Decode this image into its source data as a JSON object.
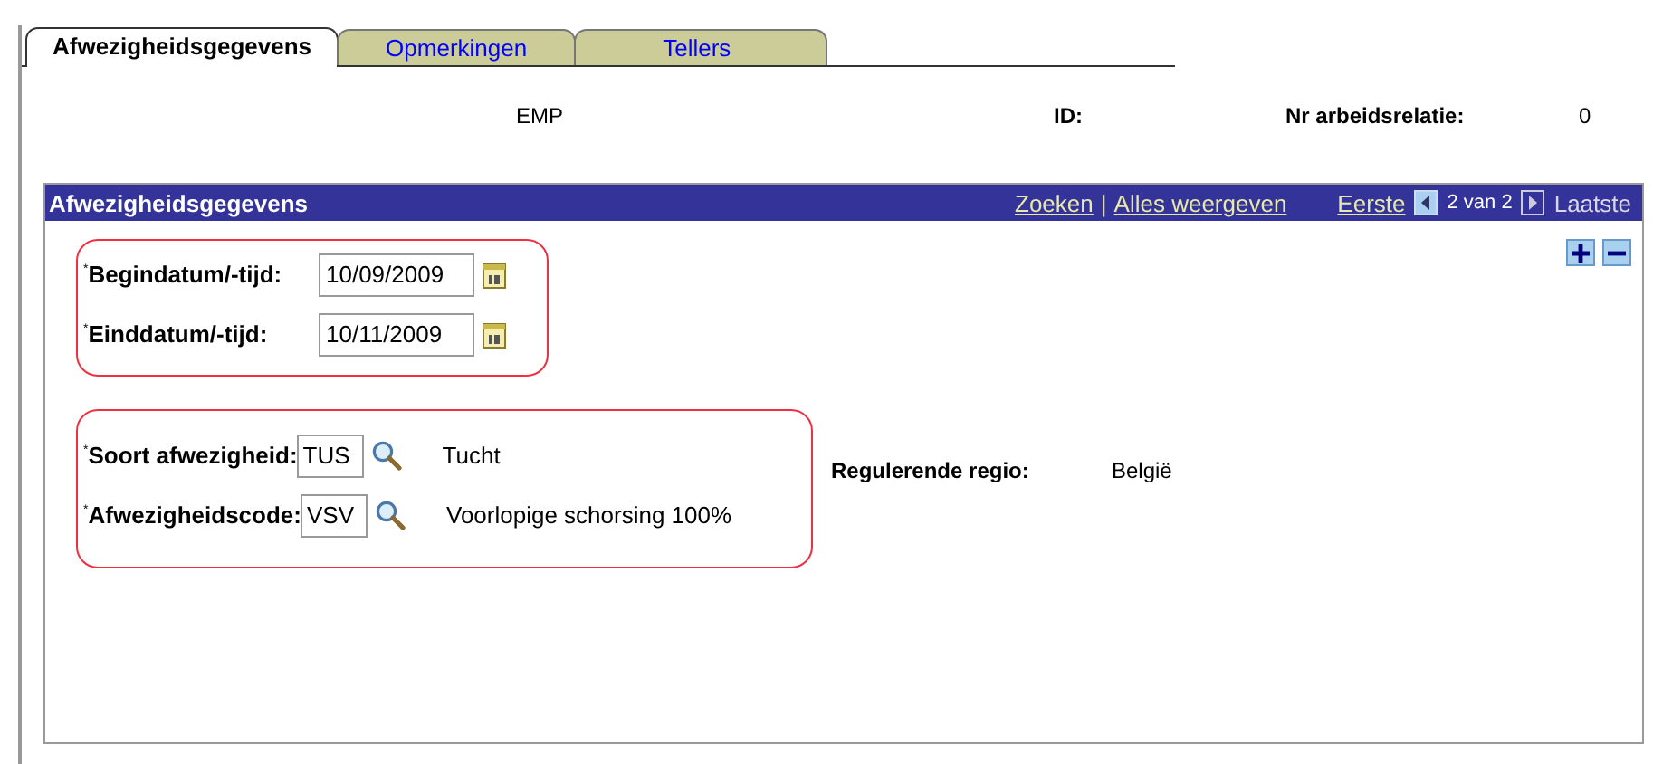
{
  "tabs": [
    {
      "label": "Afwezigheidsgegevens",
      "selected": true
    },
    {
      "label": "Opmerkingen",
      "selected": false
    },
    {
      "label": "Tellers",
      "selected": false
    }
  ],
  "header": {
    "employee": "EMP",
    "id_label": "ID:",
    "relation_label": "Nr arbeidsrelatie:",
    "relation_value": "0"
  },
  "panel": {
    "title": "Afwezigheidsgegevens",
    "links": [
      "Zoeken",
      "Alles weergeven"
    ],
    "separator": "|",
    "nav": {
      "first": {
        "label": "Eerste",
        "disabled": false
      },
      "position": "2 van 2",
      "last": {
        "label": "Laatste",
        "disabled": true
      }
    },
    "date_fields": [
      {
        "label": "$^{*}$Begindatum/-tijd:",
        "value": "10/09/2009"
      },
      {
        "label": "$^{*}$Einddatum/-tijd:",
        "value": "10/11/2009"
      }
    ],
    "code_fields": [
      {
        "label": "$^{*}$Soort afwezigheid:",
        "value": "TUS",
        "description": "Tucht"
      },
      {
        "label": "$^{*}$Afwezigheidscode:",
        "value": "VSV",
        "description": "Voorlopige schorsing 100%"
      }
    ],
    "region": {
      "label": "Regulerende regio:",
      "value": "België"
    }
  }
}
